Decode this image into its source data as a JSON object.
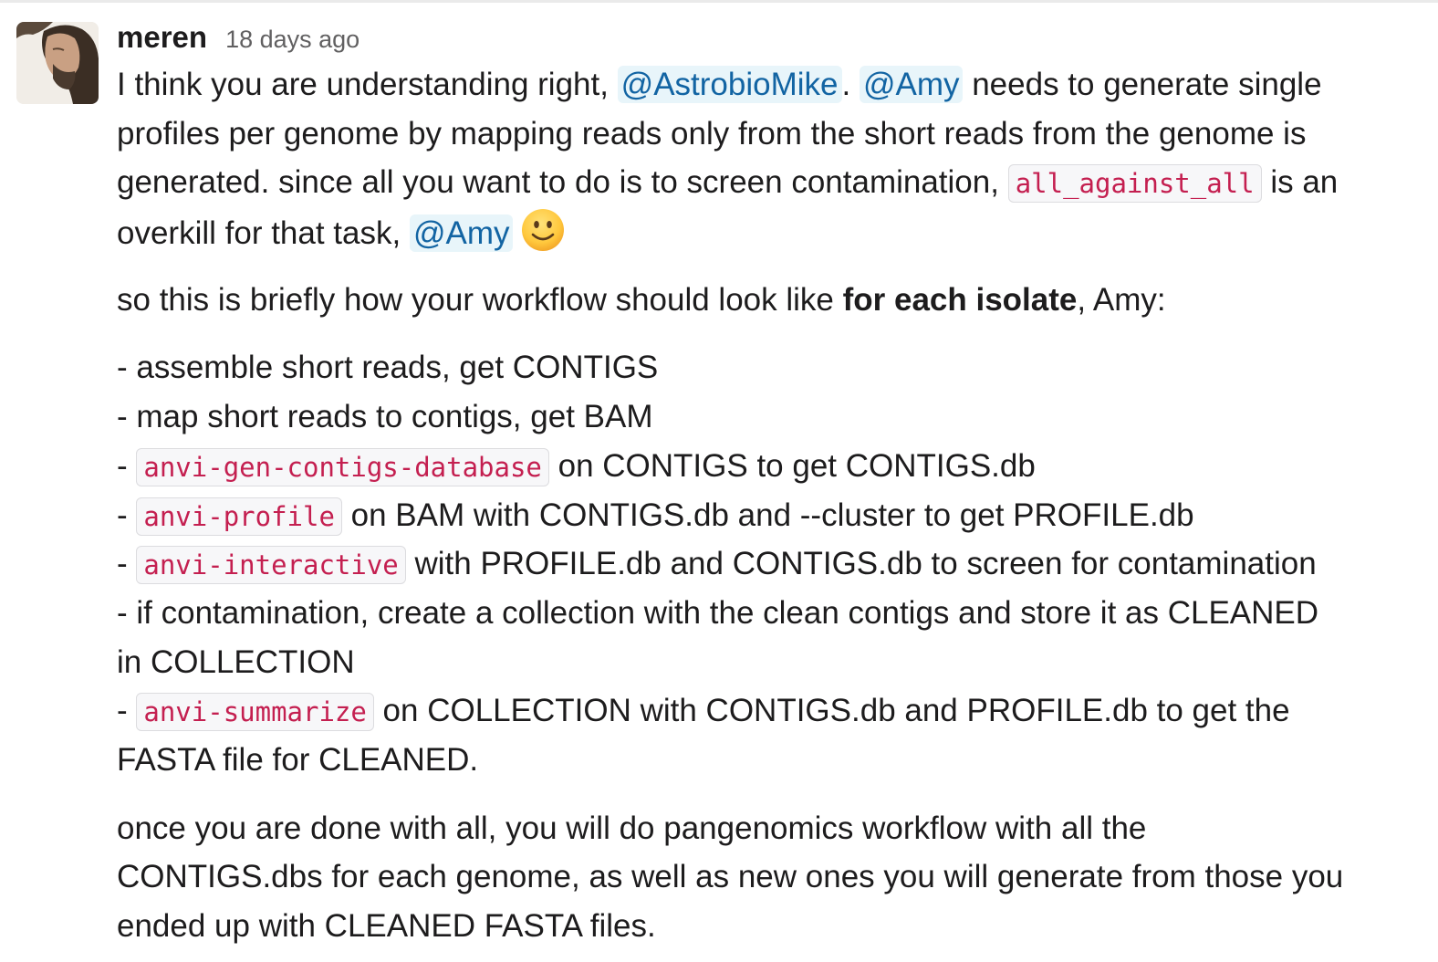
{
  "message": {
    "author": "meren",
    "timestamp": "18 days ago",
    "avatar_icon": "avatar-photo",
    "p1": {
      "l1_a": "I think you are understanding right, ",
      "l1_mention1": "@AstrobioMike",
      "l1_b": ". ",
      "l1_mention2": "@Amy",
      "l1_c": " needs to generate single",
      "l2": "profiles per genome by mapping reads only from the short reads from the genome is",
      "l3_a": "generated. since all you want to do is to screen contamination, ",
      "l3_code": "all_against_all",
      "l3_b": " is an",
      "l4_a": "overkill for that task, ",
      "l4_mention": "@Amy",
      "l4_emoji": "slightly-smiling-face-icon"
    },
    "p2": {
      "a": "so this is briefly how your workflow should look like  ",
      "bold": "for each isolate",
      "b": ", Amy:"
    },
    "p3": {
      "l1": "- assemble short reads, get CONTIGS",
      "l2": "- map short reads to contigs, get BAM",
      "l3_dash": "- ",
      "l3_code": "anvi-gen-contigs-database",
      "l3_text": " on CONTIGS to get CONTIGS.db",
      "l4_dash": "- ",
      "l4_code": "anvi-profile",
      "l4_text": " on BAM with CONTIGS.db and --cluster to get PROFILE.db",
      "l5_dash": "- ",
      "l5_code": "anvi-interactive",
      "l5_text": " with PROFILE.db and CONTIGS.db to screen for contamination",
      "l6": "- if contamination, create a collection with the clean contigs and store it as CLEANED",
      "l7": "in COLLECTION",
      "l8_dash": "- ",
      "l8_code": "anvi-summarize",
      "l8_text": " on COLLECTION with CONTIGS.db and PROFILE.db to get the",
      "l9": "FASTA file for CLEANED."
    },
    "p4": {
      "l1": "once you are done with all, you will do pangenomics workflow with all the",
      "l2": "CONTIGS.dbs for each genome, as well as new ones you will generate from those you",
      "l3": "ended up with CLEANED FASTA files."
    }
  },
  "colors": {
    "mention_bg": "#e8f5fa",
    "mention_text": "#1264a3",
    "code_text": "#c41f50",
    "code_bg": "#f7f7f9",
    "text": "#1d1c1d",
    "timestamp": "#616061"
  }
}
